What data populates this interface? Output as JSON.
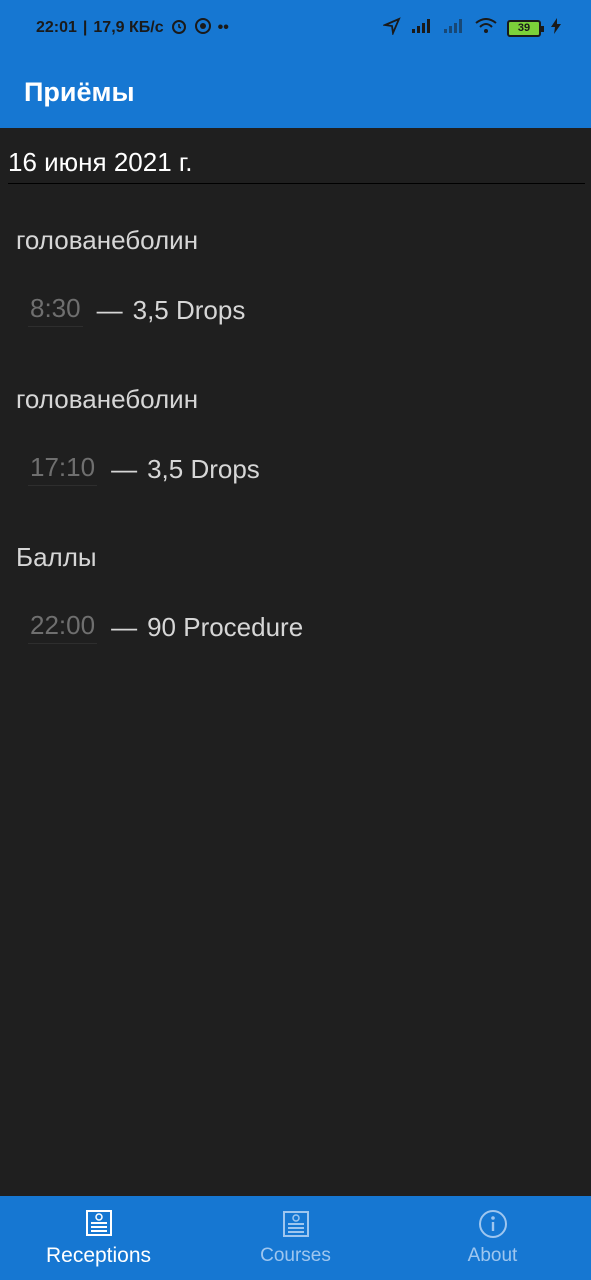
{
  "status_bar": {
    "time": "22:01",
    "separator": "|",
    "network_speed": "17,9 КБ/с",
    "dots": "••",
    "battery": "39",
    "icons": [
      "alarm-icon",
      "circle-app-icon",
      "location-arrow-icon",
      "signal-icon",
      "signal-icon",
      "wifi-icon",
      "battery-icon",
      "charging-icon"
    ]
  },
  "app_bar": {
    "title": "Приёмы"
  },
  "date": {
    "value": "16 июня 2021 г."
  },
  "entries": [
    {
      "name": "голованеболин",
      "time": "8:30",
      "dash": "—",
      "amount": "3,5 Drops"
    },
    {
      "name": "голованеболин",
      "time": "17:10",
      "dash": "—",
      "amount": "3,5 Drops"
    },
    {
      "name": "Баллы",
      "time": "22:00",
      "dash": "—",
      "amount": "90 Procedure"
    }
  ],
  "bottom_nav": {
    "items": [
      {
        "label": "Receptions",
        "icon": "document-icon",
        "active": true
      },
      {
        "label": "Courses",
        "icon": "document-icon",
        "active": false
      },
      {
        "label": "About",
        "icon": "info-icon",
        "active": false
      }
    ]
  },
  "colors": {
    "primary": "#1677d2",
    "background": "#1f1f1f",
    "text": "#d6d6d6",
    "muted": "#6f6f6f"
  }
}
